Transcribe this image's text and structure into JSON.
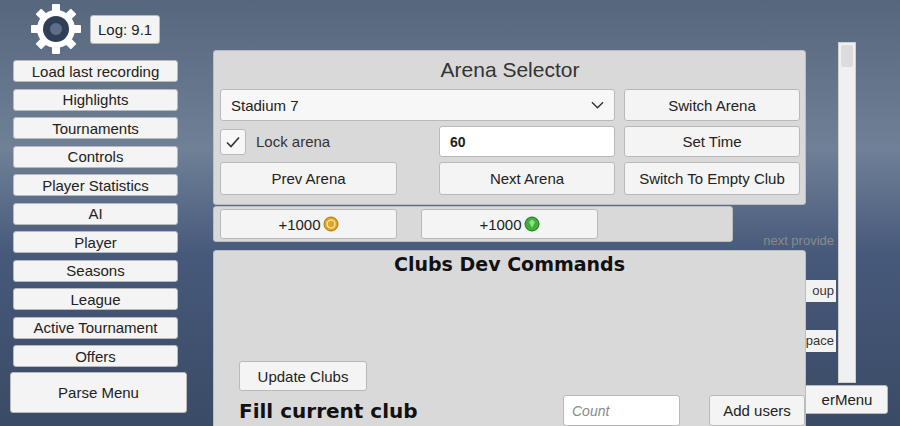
{
  "log": {
    "label": "Log: 9.1"
  },
  "sidebar": {
    "items": [
      "Load last recording",
      "Highlights",
      "Tournaments",
      "Controls",
      "Player Statistics",
      "AI",
      "Player",
      "Seasons",
      "League",
      "Active Tournament",
      "Offers"
    ],
    "parse_button": "Parse Menu"
  },
  "arena_selector": {
    "title": "Arena Selector",
    "dropdown": {
      "value": "Stadium 7"
    },
    "switch_button": "Switch Arena",
    "lock": {
      "label": "Lock arena",
      "checked": true
    },
    "time_field": {
      "value": "60"
    },
    "set_time_button": "Set Time",
    "prev_button": "Prev Arena",
    "next_button": "Next Arena",
    "empty_club_button": "Switch To Empty Club"
  },
  "currency_buttons": [
    {
      "label": "+1000",
      "kind": "coin"
    },
    {
      "label": "+1000",
      "kind": "gem"
    }
  ],
  "clubs": {
    "title": "Clubs Dev Commands",
    "update_button": "Update Clubs",
    "fill_label": "Fill current club",
    "count_field": {
      "placeholder": "Count"
    },
    "add_users_button": "Add users"
  },
  "background_menu": {
    "items": [
      "next provide",
      "oup",
      "pace"
    ],
    "button": "erMenu"
  }
}
